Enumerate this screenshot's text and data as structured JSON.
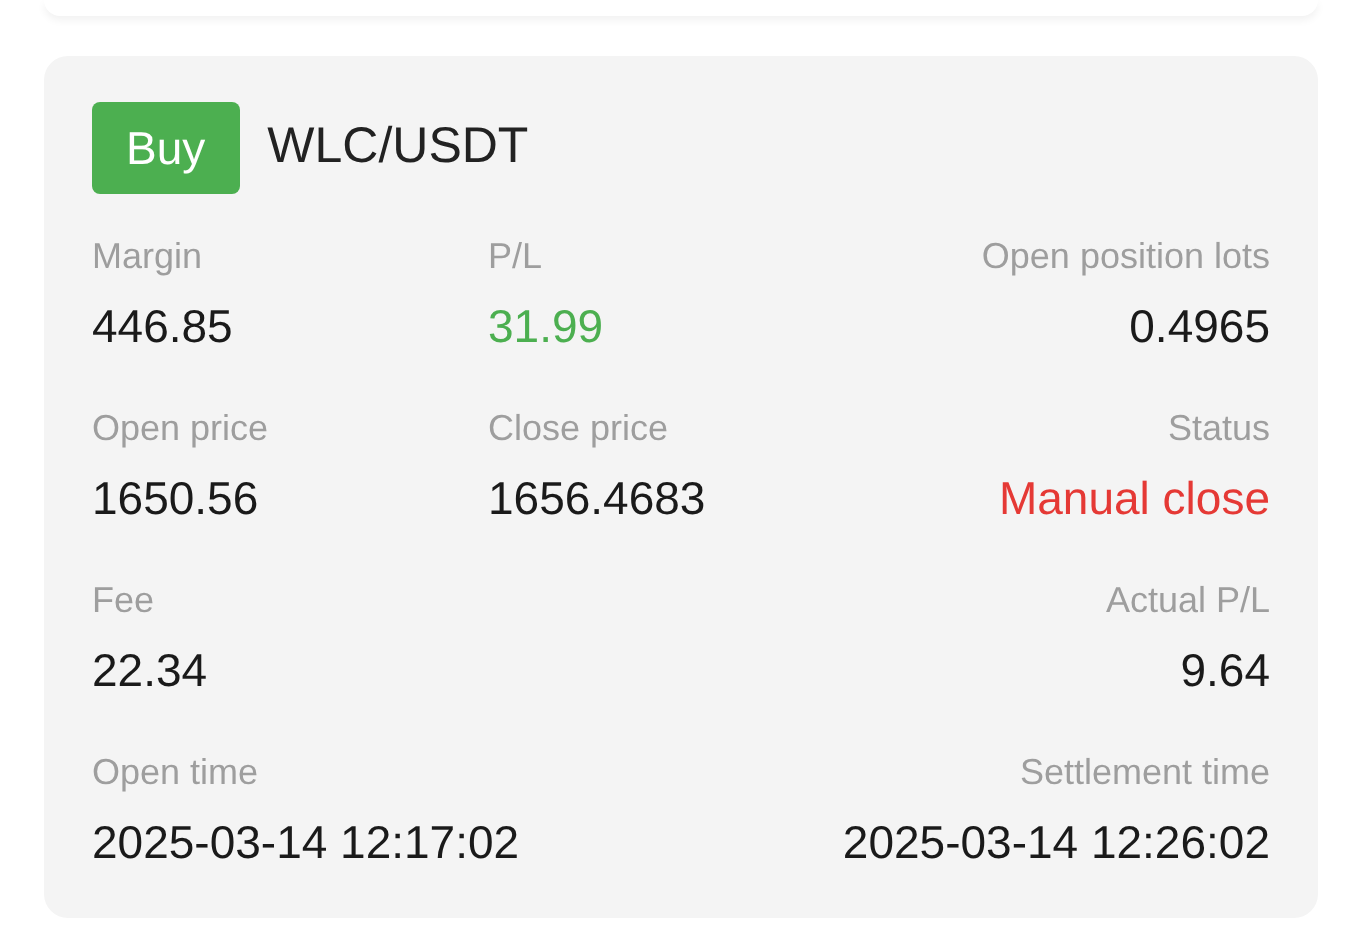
{
  "order": {
    "side": {
      "label": "Buy",
      "kind": "buy"
    },
    "pair": "WLC/USDT",
    "rows": [
      [
        {
          "label": "Margin",
          "value": "446.85",
          "kind": "plain"
        },
        {
          "label": "P/L",
          "value": "31.99",
          "kind": "gain"
        },
        {
          "label": "Open position lots",
          "value": "0.4965",
          "kind": "plain"
        }
      ],
      [
        {
          "label": "Open price",
          "value": "1650.56",
          "kind": "plain"
        },
        {
          "label": "Close price",
          "value": "1656.4683",
          "kind": "plain"
        },
        {
          "label": "Status",
          "value": "Manual close",
          "kind": "alert"
        }
      ],
      [
        {
          "label": "Fee",
          "value": "22.34",
          "kind": "plain"
        },
        {
          "label": "Actual P/L",
          "value": "9.64",
          "kind": "plain"
        }
      ],
      [
        {
          "label": "Open time",
          "value": "2025-03-14 12:17:02",
          "kind": "plain"
        },
        {
          "label": "Settlement time",
          "value": "2025-03-14 12:26:02",
          "kind": "plain"
        }
      ]
    ]
  }
}
